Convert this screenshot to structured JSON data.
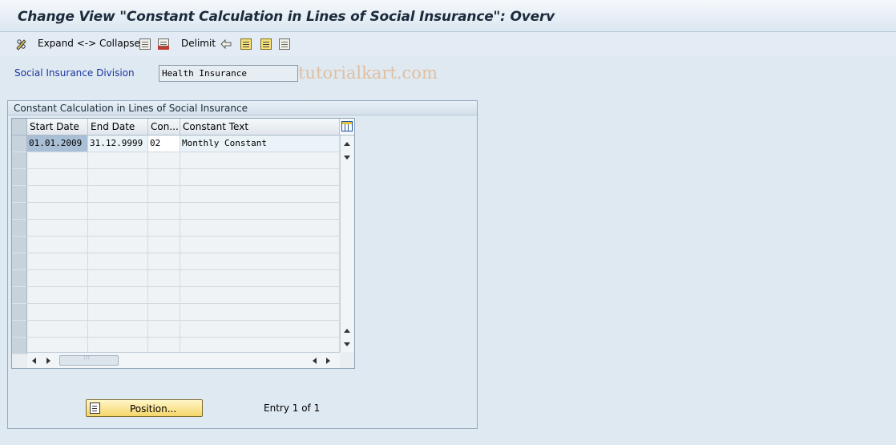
{
  "window": {
    "title": "Change View \"Constant Calculation in Lines of Social Insurance\": Overv"
  },
  "toolbar": {
    "expand_collapse_label": "Expand <-> Collapse",
    "delimit_label": "Delimit",
    "watermark": "www.tutorialkart.com",
    "icons": [
      "pencil-glasses-icon",
      "copy-icon",
      "delete-icon",
      "undo-icon",
      "select-all-icon",
      "select-block-icon",
      "deselect-icon"
    ]
  },
  "field": {
    "label": "Social Insurance Division",
    "value": "Health Insurance"
  },
  "group": {
    "title": "Constant Calculation in Lines of Social Insurance"
  },
  "table": {
    "columns": [
      "Start Date",
      "End Date",
      "Con...",
      "Constant Text"
    ],
    "rows": [
      {
        "start": "01.01.2009",
        "end": "31.12.9999",
        "con": "02",
        "text": "Monthly Constant"
      }
    ]
  },
  "footer": {
    "position_label": "Position...",
    "entry_text": "Entry 1 of 1"
  },
  "colors": {
    "background": "#dfe9f2",
    "label_blue": "#1a35a0",
    "button_yellow": "#f5d66a",
    "selected_cell": "#a9bfd6"
  }
}
